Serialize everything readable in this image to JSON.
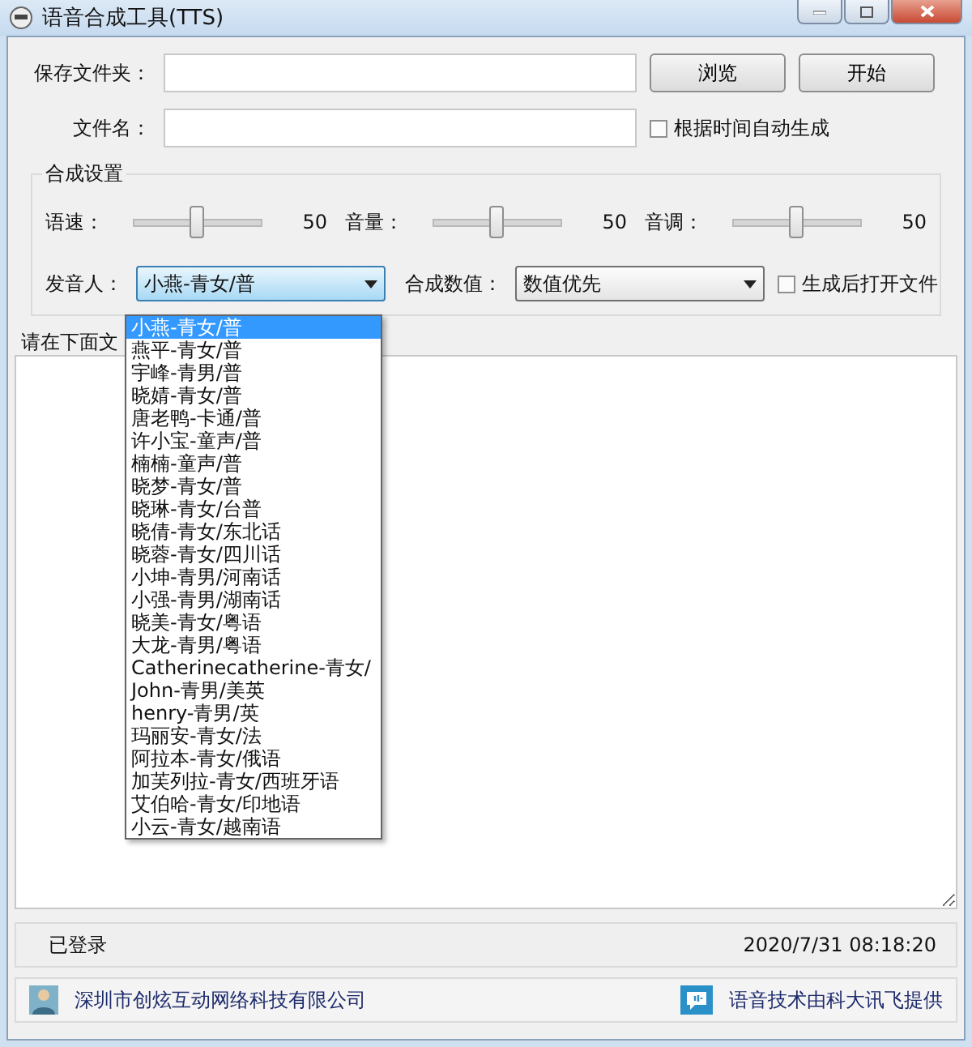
{
  "window": {
    "title": "语音合成工具(TTS)"
  },
  "save_folder": {
    "label": "保存文件夹："
  },
  "buttons": [
    "浏览",
    "开始"
  ],
  "file_name": {
    "label": "文件名："
  },
  "auto_generate": {
    "label": "根据时间自动生成",
    "checked": false
  },
  "synthesis": {
    "title": "合成设置",
    "sliders": [
      {
        "label": "语速：",
        "level": 0.5,
        "reading": "50"
      },
      {
        "label": "音量：",
        "level": 0.5,
        "reading": "50"
      },
      {
        "label": "音调：",
        "level": 0.5,
        "reading": "50"
      }
    ],
    "speaker": {
      "label": "发音人：",
      "value": "小燕-青女/普",
      "expanded": true,
      "options": [
        {
          "label": "小燕-青女/普",
          "selected": true
        },
        {
          "label": "燕平-青女/普",
          "selected": false
        },
        {
          "label": "宇峰-青男/普",
          "selected": false
        },
        {
          "label": "晓婧-青女/普",
          "selected": false
        },
        {
          "label": "唐老鸭-卡通/普",
          "selected": false
        },
        {
          "label": "许小宝-童声/普",
          "selected": false
        },
        {
          "label": "楠楠-童声/普",
          "selected": false
        },
        {
          "label": "晓梦-青女/普",
          "selected": false
        },
        {
          "label": "晓琳-青女/台普",
          "selected": false
        },
        {
          "label": "晓倩-青女/东北话",
          "selected": false
        },
        {
          "label": "晓蓉-青女/四川话",
          "selected": false
        },
        {
          "label": "小坤-青男/河南话",
          "selected": false
        },
        {
          "label": "小强-青男/湖南话",
          "selected": false
        },
        {
          "label": "晓美-青女/粤语",
          "selected": false
        },
        {
          "label": "大龙-青男/粤语",
          "selected": false
        },
        {
          "label": "Catherinecatherine-青女/",
          "selected": false
        },
        {
          "label": "John-青男/美英",
          "selected": false
        },
        {
          "label": "henry-青男/英",
          "selected": false
        },
        {
          "label": "玛丽安-青女/法",
          "selected": false
        },
        {
          "label": "阿拉本-青女/俄语",
          "selected": false
        },
        {
          "label": "加芙列拉-青女/西班牙语",
          "selected": false
        },
        {
          "label": "艾伯哈-青女/印地语",
          "selected": false
        },
        {
          "label": "小云-青女/越南语",
          "selected": false
        }
      ]
    },
    "value_mode": {
      "label": "合成数值：",
      "value": "数值优先"
    },
    "open_after": {
      "label": "生成后打开文件",
      "checked": false
    }
  },
  "text_area": {
    "label": "请在下面文"
  },
  "status": {
    "state": "已登录",
    "datetime": "2020/7/31 08:18:20"
  },
  "footer": {
    "company": "深圳市创炫互动网络科技有限公司",
    "credit": "语音技术由科大讯飞提供"
  }
}
